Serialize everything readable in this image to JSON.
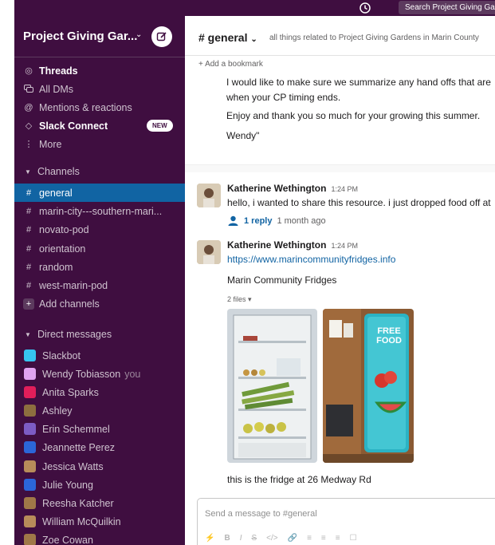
{
  "topbar": {
    "history_icon": "clock-icon",
    "search_text": "Search Project Giving Gardens"
  },
  "sidebar": {
    "workspace_name": "Project Giving Gar...",
    "workspace_chevron": "⌄",
    "nav": [
      {
        "label": "Threads",
        "icon": "threads-icon",
        "bold": true
      },
      {
        "label": "All DMs",
        "icon": "dms-icon"
      },
      {
        "label": "Mentions & reactions",
        "icon": "at-icon"
      },
      {
        "label": "Slack Connect",
        "icon": "connect-icon",
        "bold": true,
        "badge": "NEW"
      },
      {
        "label": "More",
        "icon": "more-icon"
      }
    ],
    "channels_header": "Channels",
    "channels": [
      {
        "name": "general",
        "active": true
      },
      {
        "name": "marin-city---southern-mari..."
      },
      {
        "name": "novato-pod"
      },
      {
        "name": "orientation"
      },
      {
        "name": "random"
      },
      {
        "name": "west-marin-pod"
      }
    ],
    "add_channels": "Add channels",
    "dm_header": "Direct messages",
    "dms": [
      {
        "name": "Slackbot",
        "color": "#36c5f0"
      },
      {
        "name": "Wendy Tobiasson",
        "you": "you",
        "color": "#e0a3f0"
      },
      {
        "name": "Anita Sparks",
        "color": "#e01e5a"
      },
      {
        "name": "Ashley",
        "color": "#8d6e3f"
      },
      {
        "name": "Erin Schemmel",
        "color": "#7c5cc4"
      },
      {
        "name": "Jeannette Perez",
        "color": "#2b66d9"
      },
      {
        "name": "Jessica Watts",
        "color": "#b88c5a"
      },
      {
        "name": "Julie Young",
        "color": "#2b66d9"
      },
      {
        "name": "Reesha Katcher",
        "color": "#a07848"
      },
      {
        "name": "William McQuilkin",
        "color": "#b88c5a"
      },
      {
        "name": "Zoe Cowan",
        "color": "#a07848"
      }
    ]
  },
  "channel": {
    "name": "# general",
    "chevron": "⌄",
    "description": "all things related to Project Giving Gardens in Marin County",
    "bookmark": "+ Add a bookmark"
  },
  "prev_message": {
    "line1": "I would like to make sure we summarize any hand offs that are",
    "line2": "when your CP timing ends.",
    "line3": "Enjoy and thank you so much for your growing this summer.",
    "line4": "Wendy\""
  },
  "messages": [
    {
      "author": "Katherine Wethington",
      "time": "1:24 PM",
      "text": "hello, i wanted to share this resource. i just dropped food off at",
      "reply_count": "1 reply",
      "reply_time": "1 month ago"
    },
    {
      "author": "Katherine Wethington",
      "time": "1:24 PM",
      "link": "https://www.marincommunityfridges.info",
      "link_title": "Marin Community Fridges",
      "files_label": "2 files",
      "files_chevron": "▾",
      "image2_text": "FREE FOOD",
      "caption": "this is the fridge at 26 Medway Rd"
    }
  ],
  "composer": {
    "placeholder": "Send a message to #general",
    "tools": [
      "⚡",
      "B",
      "I",
      "S",
      "</>",
      "🔗",
      "≡",
      "≡",
      "≡",
      "☐"
    ]
  }
}
